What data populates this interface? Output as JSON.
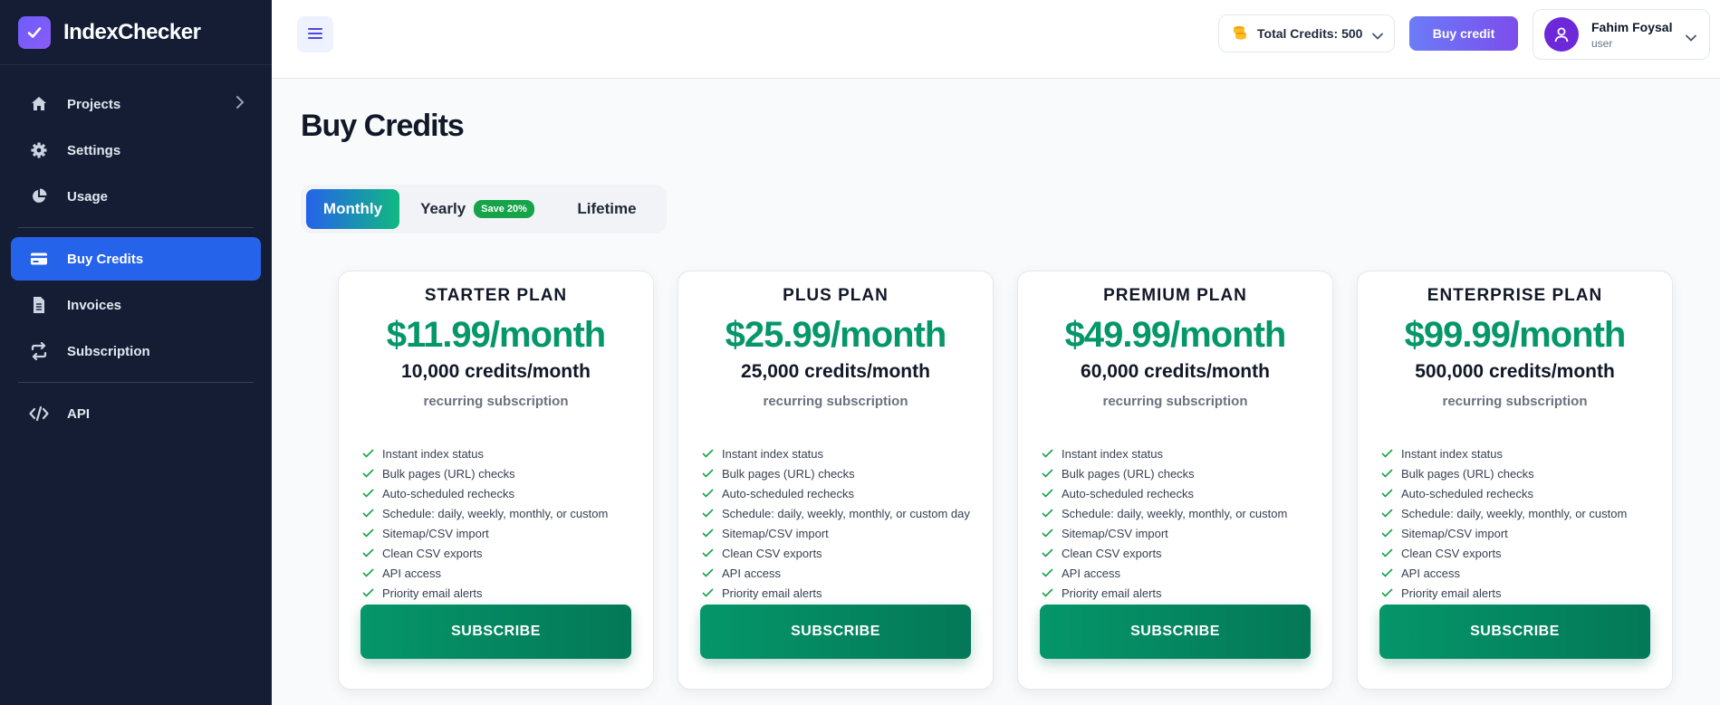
{
  "app": {
    "name": "IndexChecker"
  },
  "sidebar": {
    "items": [
      {
        "label": "Projects",
        "icon": "home-icon"
      },
      {
        "label": "Settings",
        "icon": "gear-icon"
      },
      {
        "label": "Usage",
        "icon": "pie-chart-icon"
      },
      {
        "label": "Buy Credits",
        "icon": "credit-card-icon",
        "active": true
      },
      {
        "label": "Invoices",
        "icon": "document-icon"
      },
      {
        "label": "Subscription",
        "icon": "refresh-icon"
      },
      {
        "label": "API",
        "icon": "code-icon"
      }
    ]
  },
  "header": {
    "total_credits_label": "Total Credits: 500",
    "buy_credit_label": "Buy credit",
    "user": {
      "name": "Fahim Foysal",
      "role": "user"
    }
  },
  "main": {
    "title": "Buy Credits",
    "tabs": [
      {
        "label": "Monthly",
        "active": true
      },
      {
        "label": "Yearly",
        "badge": "Save 20%"
      },
      {
        "label": "Lifetime"
      }
    ],
    "plans": [
      {
        "name": "STARTER PLAN",
        "price": "$11.99/month",
        "credits": "10,000 credits/month",
        "billing": "recurring subscription",
        "features": [
          "Instant index status",
          "Bulk pages (URL) checks",
          "Auto-scheduled rechecks",
          "Schedule: daily, weekly, monthly, or custom",
          "Sitemap/CSV import",
          "Clean CSV exports",
          "API access",
          "Priority email alerts"
        ],
        "button": "SUBSCRIBE"
      },
      {
        "name": "PLUS PLAN",
        "price": "$25.99/month",
        "credits": "25,000 credits/month",
        "billing": "recurring subscription",
        "features": [
          "Instant index status",
          "Bulk pages (URL) checks",
          "Auto-scheduled rechecks",
          "Schedule: daily, weekly, monthly, or custom day",
          "Sitemap/CSV import",
          "Clean CSV exports",
          "API access",
          "Priority email alerts"
        ],
        "button": "SUBSCRIBE"
      },
      {
        "name": "PREMIUM PLAN",
        "price": "$49.99/month",
        "credits": "60,000 credits/month",
        "billing": "recurring subscription",
        "features": [
          "Instant index status",
          "Bulk pages (URL) checks",
          "Auto-scheduled rechecks",
          "Schedule: daily, weekly, monthly, or custom",
          "Sitemap/CSV import",
          "Clean CSV exports",
          "API access",
          "Priority email alerts"
        ],
        "button": "SUBSCRIBE"
      },
      {
        "name": "ENTERPRISE PLAN",
        "price": "$99.99/month",
        "credits": "500,000 credits/month",
        "billing": "recurring subscription",
        "features": [
          "Instant index status",
          "Bulk pages (URL) checks",
          "Auto-scheduled rechecks",
          "Schedule: daily, weekly, monthly, or custom",
          "Sitemap/CSV import",
          "Clean CSV exports",
          "API access",
          "Priority email alerts"
        ],
        "button": "SUBSCRIBE"
      }
    ]
  },
  "colors": {
    "sidebar_bg": "#141d33",
    "active_nav": "#2563eb",
    "price_green": "#059669",
    "subscribe_green": "#047857",
    "buy_credit_purple": "#7c4deb"
  }
}
